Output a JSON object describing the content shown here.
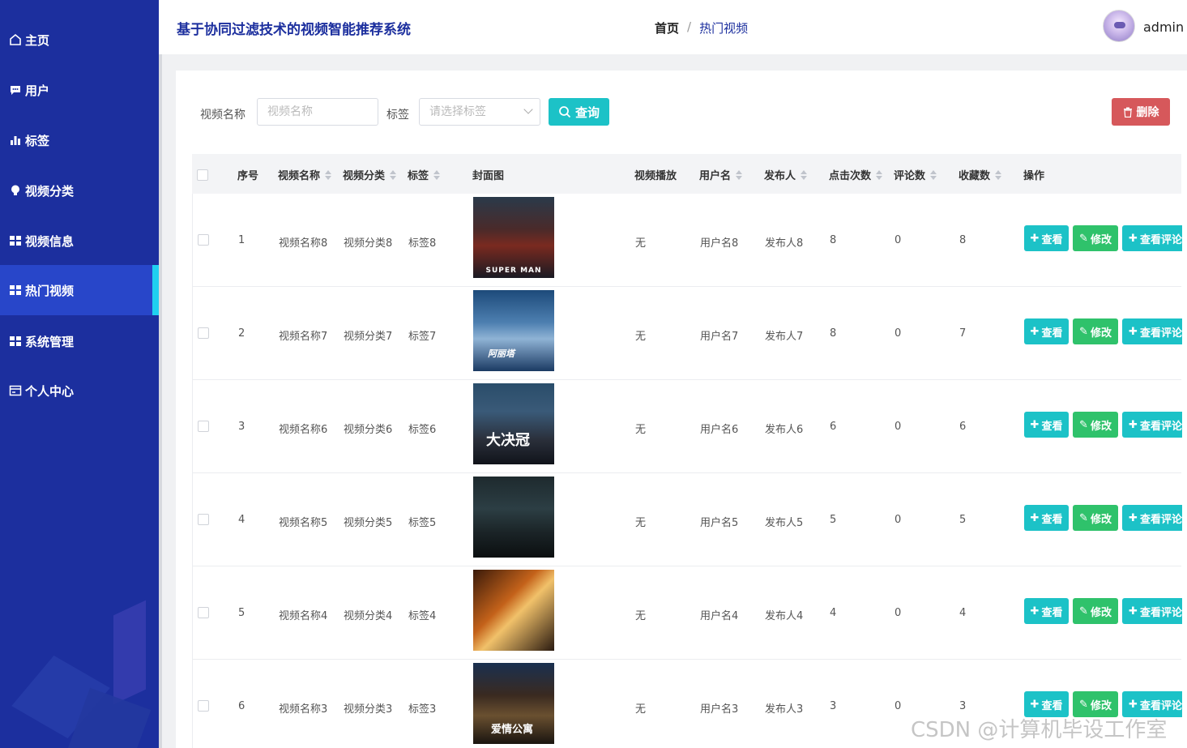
{
  "header": {
    "system_title": "基于协同过滤技术的视频智能推荐系统",
    "breadcrumb_home": "首页",
    "breadcrumb_sep": "/",
    "breadcrumb_current": "热门视频",
    "username": "admin"
  },
  "sidebar": {
    "items": [
      {
        "label": "主页",
        "icon": "home-icon"
      },
      {
        "label": "用户",
        "icon": "chat-icon"
      },
      {
        "label": "标签",
        "icon": "bar-chart-icon"
      },
      {
        "label": "视频分类",
        "icon": "bulb-icon"
      },
      {
        "label": "视频信息",
        "icon": "grid-icon"
      },
      {
        "label": "热门视频",
        "icon": "grid-icon",
        "active": true
      },
      {
        "label": "系统管理",
        "icon": "grid-icon"
      },
      {
        "label": "个人中心",
        "icon": "card-icon"
      }
    ]
  },
  "filters": {
    "name_label": "视频名称",
    "name_placeholder": "视频名称",
    "tag_label": "标签",
    "tag_placeholder": "请选择标签",
    "query_button": "查询",
    "delete_button": "删除"
  },
  "table": {
    "columns": [
      "序号",
      "视频名称",
      "视频分类",
      "标签",
      "封面图",
      "视频播放",
      "用户名",
      "发布人",
      "点击次数",
      "评论数",
      "收藏数",
      "操作"
    ],
    "rows": [
      {
        "index": "1",
        "name": "视频名称8",
        "category": "视频分类8",
        "tag": "标签8",
        "cover_text": "SUPER MAN",
        "play": "无",
        "user": "用户名8",
        "publisher": "发布人8",
        "clicks": "8",
        "comments": "0",
        "favorites": "8"
      },
      {
        "index": "2",
        "name": "视频名称7",
        "category": "视频分类7",
        "tag": "标签7",
        "cover_text": "阿丽塔",
        "play": "无",
        "user": "用户名7",
        "publisher": "发布人7",
        "clicks": "8",
        "comments": "0",
        "favorites": "7"
      },
      {
        "index": "3",
        "name": "视频名称6",
        "category": "视频分类6",
        "tag": "标签6",
        "cover_text": "大决冠",
        "play": "无",
        "user": "用户名6",
        "publisher": "发布人6",
        "clicks": "6",
        "comments": "0",
        "favorites": "6"
      },
      {
        "index": "4",
        "name": "视频名称5",
        "category": "视频分类5",
        "tag": "标签5",
        "cover_text": "",
        "play": "无",
        "user": "用户名5",
        "publisher": "发布人5",
        "clicks": "5",
        "comments": "0",
        "favorites": "5"
      },
      {
        "index": "5",
        "name": "视频名称4",
        "category": "视频分类4",
        "tag": "标签4",
        "cover_text": "",
        "play": "无",
        "user": "用户名4",
        "publisher": "发布人4",
        "clicks": "4",
        "comments": "0",
        "favorites": "4"
      },
      {
        "index": "6",
        "name": "视频名称3",
        "category": "视频分类3",
        "tag": "标签3",
        "cover_text": "爱情公寓",
        "play": "无",
        "user": "用户名3",
        "publisher": "发布人3",
        "clicks": "3",
        "comments": "0",
        "favorites": "3"
      }
    ],
    "actions": {
      "view": "查看",
      "edit": "修改",
      "comments": "查看评论"
    }
  },
  "watermark": "CSDN @计算机毕设工作室",
  "colors": {
    "sidebar": "#1c2f9e",
    "active": "#2846c9",
    "accent": "#1cc2c7",
    "success": "#2fc26b",
    "danger": "#d6585b"
  }
}
